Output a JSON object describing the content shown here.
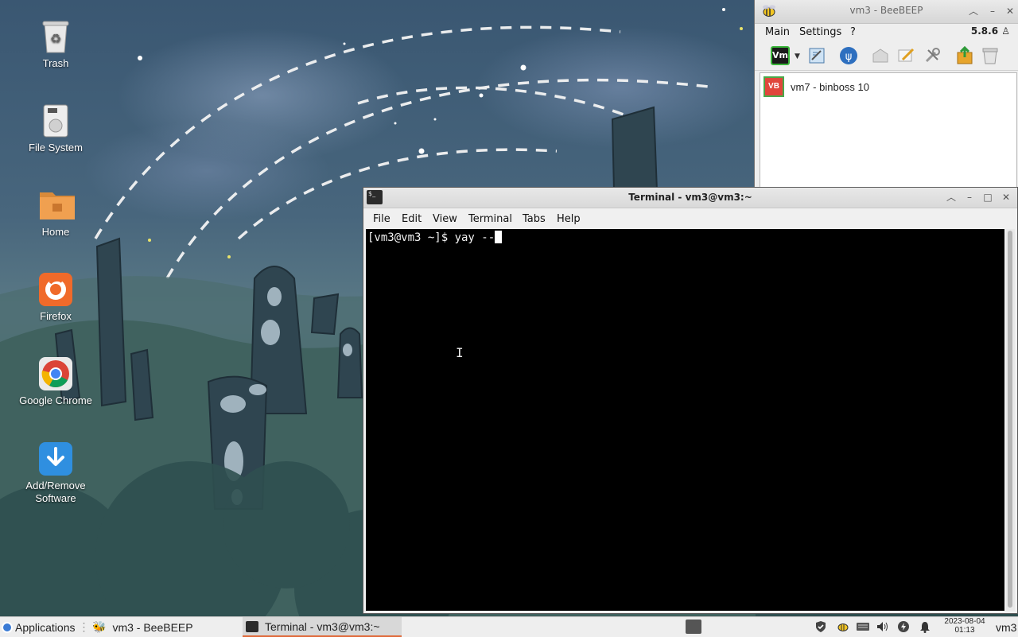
{
  "desktop": {
    "icons": [
      {
        "label": "Trash",
        "icon": "trash-icon"
      },
      {
        "label": "File System",
        "icon": "drive-icon"
      },
      {
        "label": "Home",
        "icon": "home-folder-icon"
      },
      {
        "label": "Firefox",
        "icon": "firefox-icon"
      },
      {
        "label": "Google Chrome",
        "icon": "chrome-icon"
      },
      {
        "label": "Add/Remove Software",
        "icon": "download-icon"
      }
    ]
  },
  "beebeep": {
    "title": "vm3 - BeeBEEP",
    "menu": [
      "Main",
      "Settings",
      "?"
    ],
    "version": "5.8.6",
    "toolbar": [
      "status-vm-icon",
      "edit-profile-icon",
      "network-icon",
      "broadcast-icon",
      "write-message-icon",
      "settings-tools-icon",
      "share-file-icon",
      "clear-icon"
    ],
    "status_label": "Vm",
    "users": [
      {
        "avatar": "VB",
        "name": "vm7 - binboss 10"
      }
    ]
  },
  "terminal": {
    "title": "Terminal - vm3@vm3:~",
    "menu": [
      "File",
      "Edit",
      "View",
      "Terminal",
      "Tabs",
      "Help"
    ],
    "prompt": "[vm3@vm3 ~]$ yay --",
    "icon_text": "$_"
  },
  "taskbar": {
    "applications": "Applications",
    "tasks": [
      {
        "label": "vm3 - BeeBEEP",
        "active": false
      },
      {
        "label": "Terminal - vm3@vm3:~",
        "active": true
      }
    ],
    "date": "2023-08-04",
    "time": "01:13",
    "user": "vm3"
  },
  "colors": {
    "accent_orange": "#e06a3b",
    "terminal_bg": "#000000",
    "avatar_red": "#e0463b",
    "avatar_border": "#4aa84a"
  }
}
